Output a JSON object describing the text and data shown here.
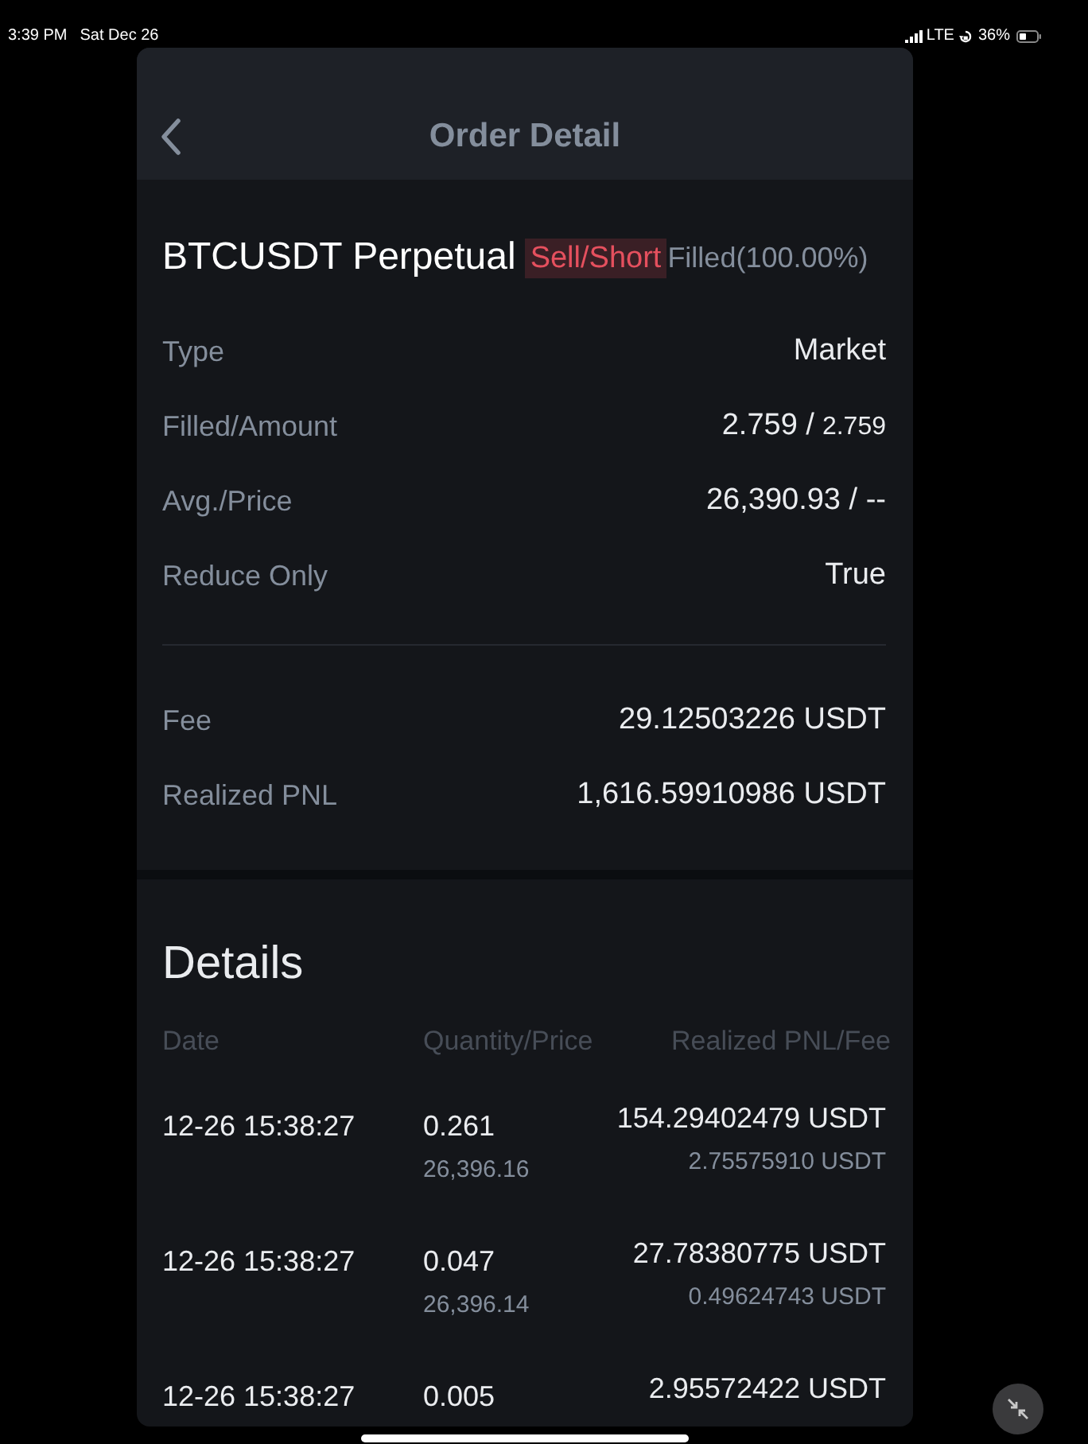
{
  "status_bar": {
    "time": "3:39 PM",
    "date": "Sat Dec 26",
    "network": "LTE",
    "battery": "36%"
  },
  "header": {
    "title": "Order Detail"
  },
  "order": {
    "symbol": "BTCUSDT Perpetual",
    "sell_side": true,
    "side_label": "Sell/Short",
    "status": "Filled(100.00%)",
    "fields": [
      {
        "label": "Type",
        "value": "Market"
      },
      {
        "label": "Filled/Amount",
        "value": "2.759 /",
        "value_secondary": "2.759"
      },
      {
        "label": "Avg./Price",
        "value": "26,390.93 / --"
      },
      {
        "label": "Reduce Only",
        "value": "True"
      }
    ],
    "totals": [
      {
        "label": "Fee",
        "value": "29.12503226 USDT"
      },
      {
        "label": "Realized PNL",
        "value": "1,616.59910986 USDT"
      }
    ]
  },
  "details": {
    "title": "Details",
    "columns": [
      "Date",
      "Quantity/Price",
      "Realized PNL/Fee"
    ],
    "rows": [
      {
        "date": "12-26 15:38:27",
        "quantity": "0.261",
        "price": "26,396.16",
        "realized_pnl": "154.29402479 USDT",
        "fee": "2.75575910 USDT"
      },
      {
        "date": "12-26 15:38:27",
        "quantity": "0.047",
        "price": "26,396.14",
        "realized_pnl": "27.78380775 USDT",
        "fee": "0.49624743 USDT"
      },
      {
        "date": "12-26 15:38:27",
        "quantity": "0.005",
        "realized_pnl": "2.95572422 USDT"
      }
    ]
  }
}
